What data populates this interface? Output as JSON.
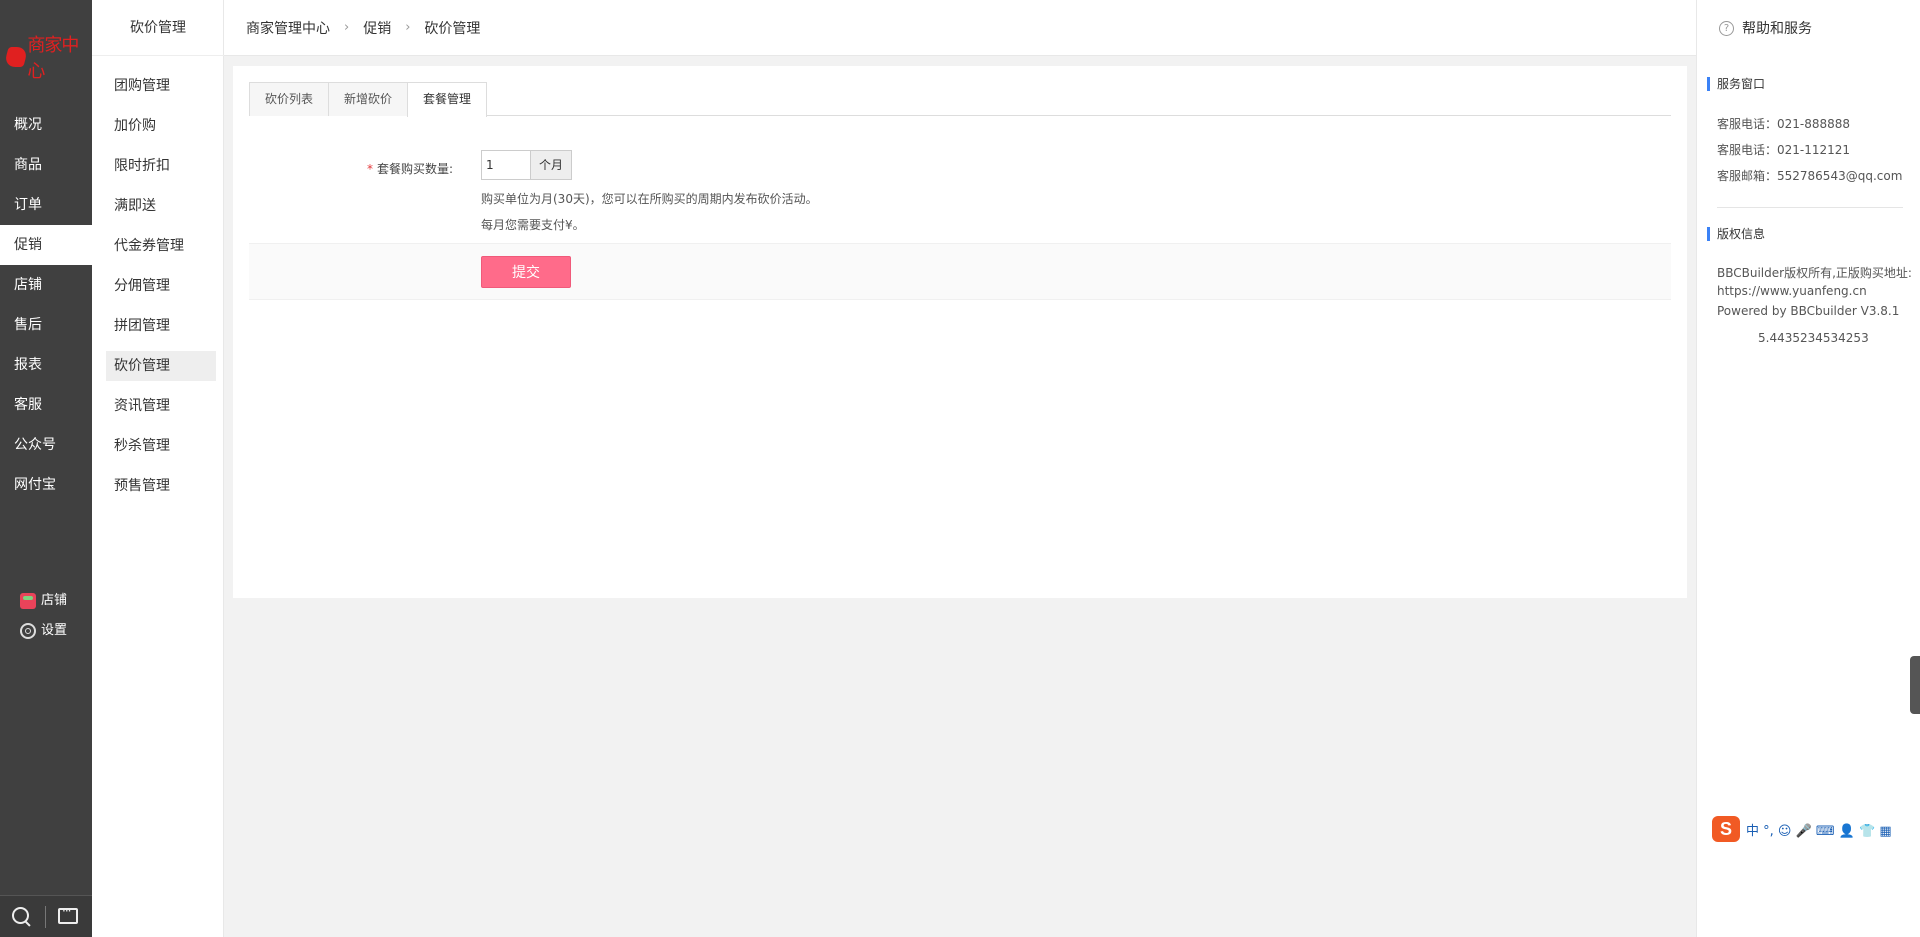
{
  "nav": {
    "logo_text": "商家中心",
    "items": [
      "概况",
      "商品",
      "订单",
      "促销",
      "店铺",
      "售后",
      "报表",
      "客服",
      "公众号",
      "网付宝"
    ],
    "active_index": 3,
    "bottom": {
      "store": "店铺",
      "settings": "设置"
    }
  },
  "submenu": {
    "title": "砍价管理",
    "items": [
      "团购管理",
      "加价购",
      "限时折扣",
      "满即送",
      "代金券管理",
      "分佣管理",
      "拼团管理",
      "砍价管理",
      "资讯管理",
      "秒杀管理",
      "预售管理"
    ],
    "active_index": 7
  },
  "breadcrumb": [
    "商家管理中心",
    "促销",
    "砍价管理"
  ],
  "tabs": [
    {
      "label": "砍价列表"
    },
    {
      "label": "新增砍价"
    },
    {
      "label": "套餐管理"
    }
  ],
  "active_tab": 2,
  "form": {
    "required_mark": "*",
    "qty_label": "套餐购买数量:",
    "qty_value": "1",
    "qty_unit": "个月",
    "help_unit": "购买单位为月(30天)，您可以在所购买的周期内发布砍价活动。",
    "help_pay": "每月您需要支付¥。",
    "submit": "提交"
  },
  "right": {
    "header": "帮助和服务",
    "service_title": "服务窗口",
    "phone1": "客服电话：021-888888",
    "phone2": "客服电话：021-112121",
    "email": "客服邮箱：552786543@qq.com",
    "copyright_title": "版权信息",
    "copyright_line1": "BBCBuilder版权所有,正版购买地址:",
    "copyright_line2": "https://www.yuanfeng.cn",
    "powered": "Powered by BBCbuilder V3.8.1",
    "build": "5.4435234534253"
  },
  "ime": {
    "logo": "S",
    "items": "中 °, ☺ 🎤 ⌨ 👤 👕 ▦"
  },
  "colors": {
    "accent": "#ff6b8a",
    "nav_bg": "#404040",
    "logo": "#e02020",
    "section_bar": "#3b82f6"
  }
}
